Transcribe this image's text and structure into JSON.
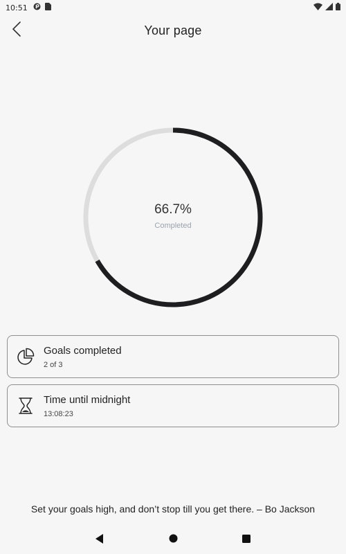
{
  "status_bar": {
    "time": "10:51"
  },
  "header": {
    "title": "Your page"
  },
  "progress": {
    "percent_text": "66.7%",
    "fraction": 0.667,
    "caption": "Completed",
    "track_color": "#dddddd",
    "fill_color": "#1e1e21"
  },
  "cards": [
    {
      "title": "Goals completed",
      "subtitle": "2 of 3",
      "icon": "pie-chart-icon"
    },
    {
      "title": "Time until midnight",
      "subtitle": "13:08:23",
      "icon": "hourglass-icon"
    }
  ],
  "quote": "Set your goals high, and don’t stop till you get there. – Bo Jackson"
}
